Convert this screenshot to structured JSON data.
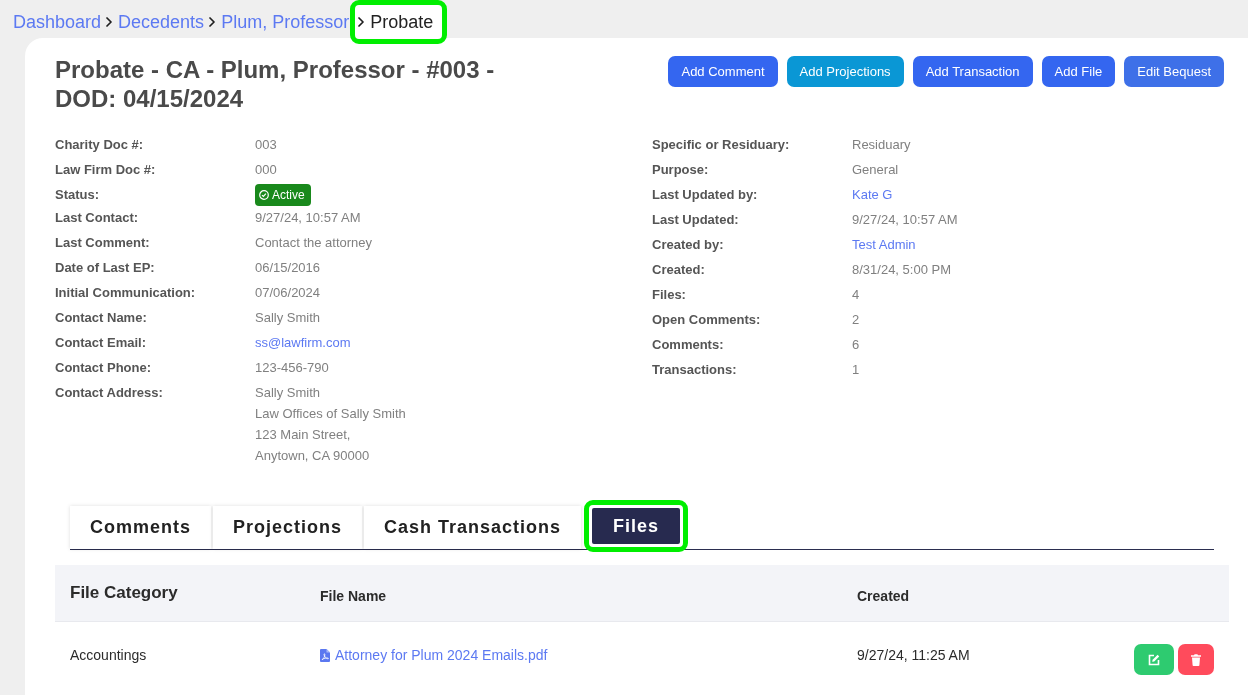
{
  "breadcrumb": [
    {
      "label": "Dashboard",
      "current": false,
      "highlighted": false
    },
    {
      "label": "Decedents",
      "current": false,
      "highlighted": false
    },
    {
      "label": "Plum, Professor",
      "current": false,
      "highlighted": false
    },
    {
      "label": "Probate",
      "current": true,
      "highlighted": true
    }
  ],
  "header": {
    "title": "Probate - CA - Plum, Professor - #003 - DOD: 04/15/2024",
    "buttons": [
      "Add Comment",
      "Add Projections",
      "Add Transaction",
      "Add File",
      "Edit Bequest"
    ]
  },
  "details": {
    "left": [
      {
        "label": "Charity Doc #:",
        "kind": "text",
        "value": "003"
      },
      {
        "label": "Law Firm Doc #:",
        "kind": "text",
        "value": "000"
      },
      {
        "label": "Status:",
        "kind": "badge",
        "value": "Active"
      },
      {
        "label": "Last Contact:",
        "kind": "text",
        "value": "9/27/24, 10:57 AM"
      },
      {
        "label": "Last Comment:",
        "kind": "text",
        "value": "Contact the attorney"
      },
      {
        "label": "Date of Last EP:",
        "kind": "text",
        "value": "06/15/2016"
      },
      {
        "label": "Initial Communication:",
        "kind": "text",
        "value": "07/06/2024"
      },
      {
        "label": "Contact Name:",
        "kind": "text",
        "value": "Sally Smith"
      },
      {
        "label": "Contact Email:",
        "kind": "link",
        "value": "ss@lawfirm.com"
      },
      {
        "label": "Contact Phone:",
        "kind": "text",
        "value": "123-456-790"
      },
      {
        "label": "Contact Address:",
        "kind": "address",
        "lines": [
          "Sally Smith",
          "Law Offices of Sally Smith",
          "123 Main Street,",
          "Anytown, CA 90000"
        ]
      }
    ],
    "right": [
      {
        "label": "Specific or Residuary:",
        "kind": "text",
        "value": "Residuary"
      },
      {
        "label": "Purpose:",
        "kind": "text",
        "value": "General"
      },
      {
        "label": "Last Updated by:",
        "kind": "link",
        "value": "Kate G"
      },
      {
        "label": "Last Updated:",
        "kind": "text",
        "value": "9/27/24, 10:57 AM"
      },
      {
        "label": "Created by:",
        "kind": "link",
        "value": "Test Admin"
      },
      {
        "label": "Created:",
        "kind": "text",
        "value": "8/31/24, 5:00 PM"
      },
      {
        "label": "Files:",
        "kind": "text",
        "value": "4"
      },
      {
        "label": "Open Comments:",
        "kind": "text",
        "value": "2"
      },
      {
        "label": "Comments:",
        "kind": "text",
        "value": "6"
      },
      {
        "label": "Transactions:",
        "kind": "text",
        "value": "1"
      }
    ]
  },
  "tabs": [
    {
      "label": "Comments",
      "selected": false,
      "highlighted": false
    },
    {
      "label": "Projections",
      "selected": false,
      "highlighted": false
    },
    {
      "label": "Cash Transactions",
      "selected": false,
      "highlighted": false
    },
    {
      "label": "Files",
      "selected": true,
      "highlighted": true
    }
  ],
  "table": {
    "columns": [
      "File Category",
      "File Name",
      "Created"
    ],
    "rows": [
      {
        "category": "Accountings",
        "file_name": "Attorney for Plum 2024 Emails.pdf",
        "created": "9/27/24, 11:25 AM",
        "actions": [
          {
            "kind": "edit"
          },
          {
            "kind": "delete"
          }
        ]
      }
    ]
  }
}
